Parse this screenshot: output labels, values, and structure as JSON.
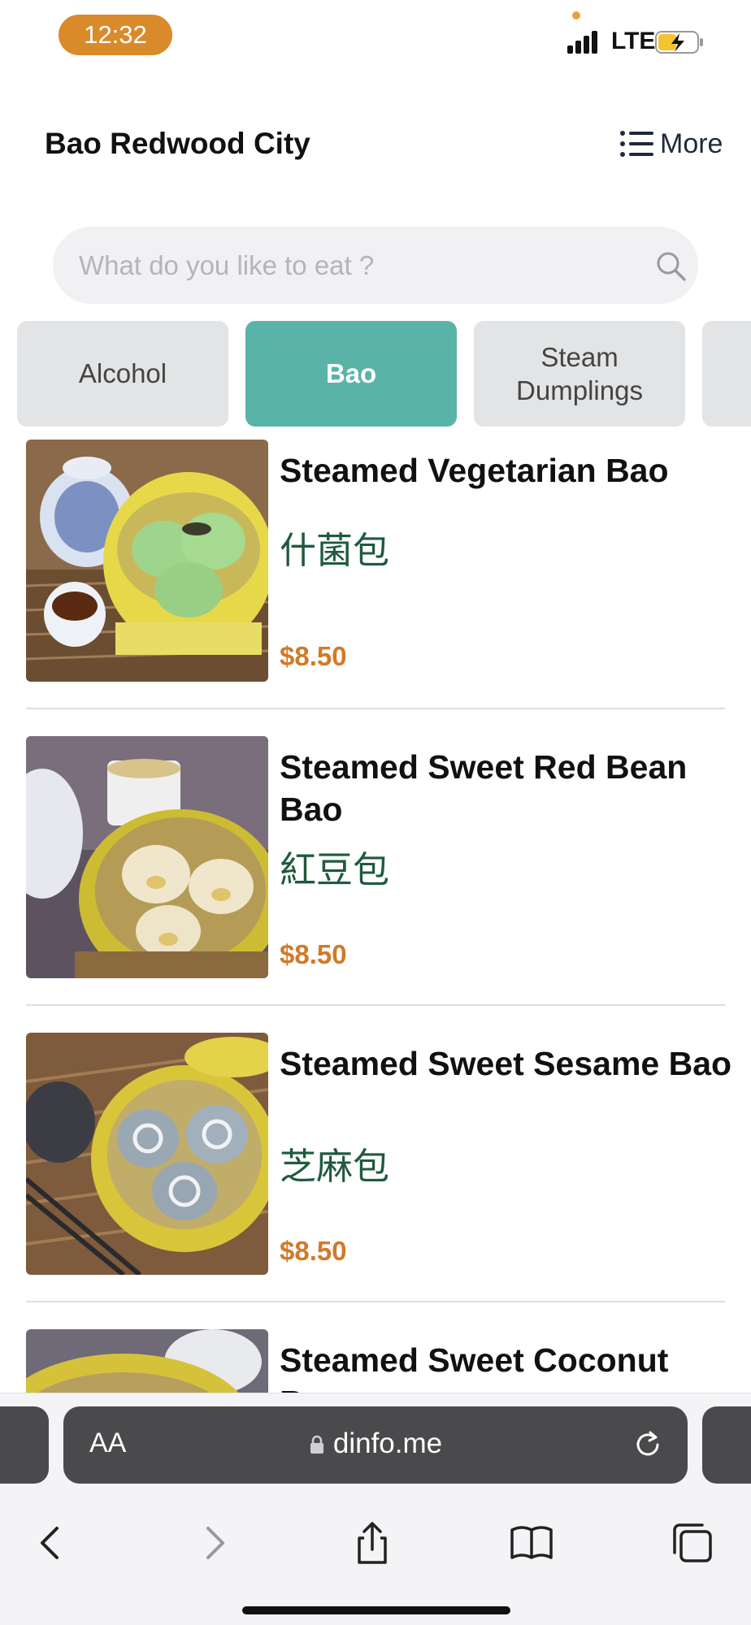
{
  "status_bar": {
    "time": "12:32",
    "network": "LTE",
    "battery_icon": "battery-charging-icon",
    "time_pill_color": "#d98a2b"
  },
  "header": {
    "title": "Bao Redwood City",
    "more_label": "More",
    "more_icon": "list-icon"
  },
  "search": {
    "placeholder": "What do you like to eat ?",
    "value": "",
    "icon": "search-icon"
  },
  "categories": [
    {
      "label": "Alcohol",
      "active": false
    },
    {
      "label": "Bao",
      "active": true
    },
    {
      "label": "Steam Dumplings",
      "active": false
    },
    {
      "label": "",
      "active": false
    }
  ],
  "menu_items": [
    {
      "name": "Steamed Vegetarian Bao",
      "chinese": "什菌包",
      "price": "$8.50"
    },
    {
      "name": "Steamed Sweet Red Bean Bao",
      "chinese": "紅豆包",
      "price": "$8.50"
    },
    {
      "name": "Steamed Sweet Sesame Bao",
      "chinese": "芝麻包",
      "price": "$8.50"
    },
    {
      "name": "Steamed Sweet Coconut Bao",
      "chinese": "",
      "price": ""
    }
  ],
  "browser": {
    "text_size_label": "AA",
    "url": "dinfo.me",
    "icons": [
      "lock-icon",
      "reload-icon",
      "back-icon",
      "forward-icon",
      "share-icon",
      "bookmarks-icon",
      "tabs-icon"
    ]
  },
  "colors": {
    "accent": "#59b3a7",
    "price": "#d07a28",
    "chinese_text": "#1f5a3d"
  }
}
